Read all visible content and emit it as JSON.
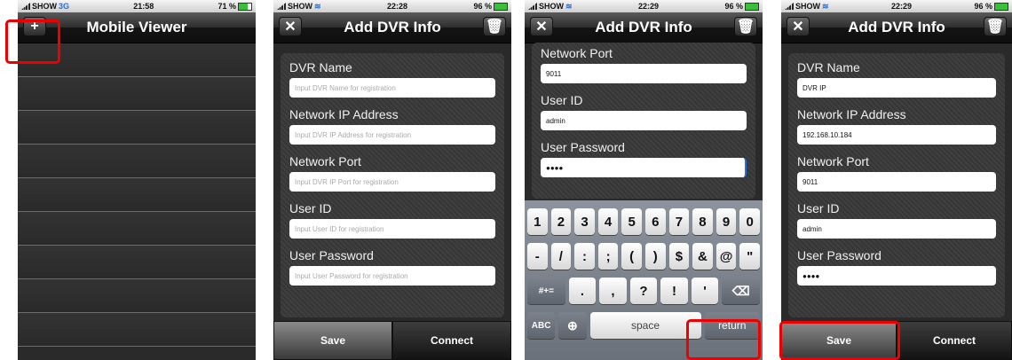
{
  "screens": [
    {
      "status": {
        "carrier": "SHOW",
        "network": "3G",
        "time": "21:58",
        "battery": "71 %"
      },
      "title": "Mobile Viewer",
      "add_icon": "+"
    },
    {
      "status": {
        "carrier": "SHOW",
        "time": "22:28",
        "battery": "96 %"
      },
      "title": "Add DVR Info",
      "fields": [
        {
          "label": "DVR Name",
          "placeholder": "Input DVR Name for registration"
        },
        {
          "label": "Network IP Address",
          "placeholder": "Input DVR IP Address for registration"
        },
        {
          "label": "Network Port",
          "placeholder": "Input DVR IP Port for registration"
        },
        {
          "label": "User ID",
          "placeholder": "Input User ID for registration"
        },
        {
          "label": "User Password",
          "placeholder": "Input User Password for registration"
        }
      ],
      "save": "Save",
      "connect": "Connect"
    },
    {
      "status": {
        "carrier": "SHOW",
        "time": "22:29",
        "battery": "96 %"
      },
      "title": "Add DVR Info",
      "fields": [
        {
          "label": "Network Port",
          "value": "9011"
        },
        {
          "label": "User ID",
          "value": "admin"
        },
        {
          "label": "User Password",
          "value": "●●●●"
        }
      ],
      "keyboard": {
        "row1": [
          "1",
          "2",
          "3",
          "4",
          "5",
          "6",
          "7",
          "8",
          "9",
          "0"
        ],
        "row2": [
          "-",
          "/",
          ":",
          ";",
          "(",
          ")",
          "$",
          "&",
          "@",
          "\""
        ],
        "row3": [
          "#+=",
          ".",
          ",",
          "?",
          "!",
          "'",
          "⌫"
        ],
        "row4": [
          "ABC",
          "⊕",
          "space",
          "return"
        ]
      }
    },
    {
      "status": {
        "carrier": "SHOW",
        "time": "22:29",
        "battery": "96 %"
      },
      "title": "Add DVR Info",
      "fields": [
        {
          "label": "DVR Name",
          "value": "DVR IP"
        },
        {
          "label": "Network IP Address",
          "value": "192.168.10.184"
        },
        {
          "label": "Network Port",
          "value": "9011"
        },
        {
          "label": "User ID",
          "value": "admin"
        },
        {
          "label": "User Password",
          "value": "●●●●"
        }
      ],
      "save": "Save",
      "connect": "Connect"
    }
  ],
  "colors": {
    "highlight": "#e00000",
    "keyboard": "#7c838d"
  },
  "icons": {
    "add": "plus-icon",
    "close": "close-icon",
    "delete": "trash-icon",
    "globe": "globe-icon",
    "backspace": "backspace-icon"
  }
}
